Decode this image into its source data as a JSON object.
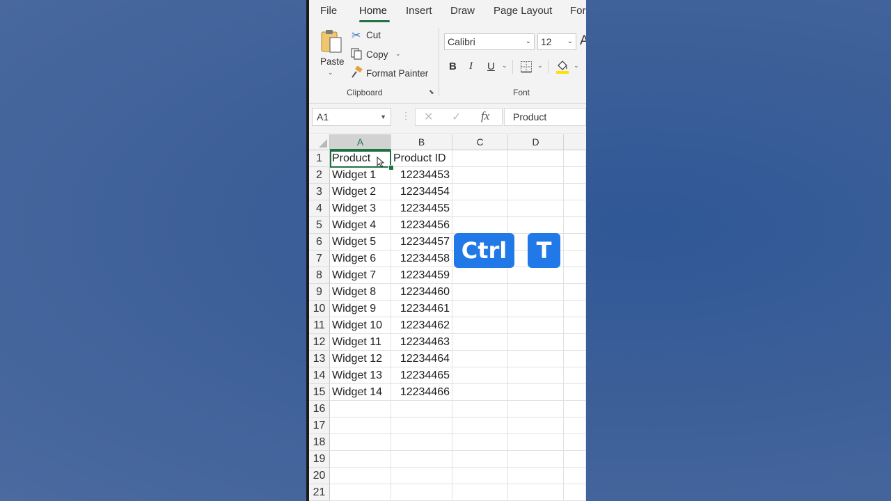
{
  "ribbon": {
    "tabs": [
      "File",
      "Home",
      "Insert",
      "Draw",
      "Page Layout",
      "For"
    ],
    "active_tab": "Home",
    "clipboard": {
      "paste_label": "Paste",
      "cut_label": "Cut",
      "copy_label": "Copy",
      "format_painter_label": "Format Painter",
      "group_label": "Clipboard"
    },
    "font": {
      "font_name": "Calibri",
      "font_size": "12",
      "bold": "B",
      "italic": "I",
      "underline": "U",
      "group_label": "Font"
    }
  },
  "formula_bar": {
    "name_box": "A1",
    "fx_label": "fx",
    "cancel_glyph": "✕",
    "enter_glyph": "✓",
    "content": "Product"
  },
  "sheet": {
    "columns": [
      "A",
      "B",
      "C",
      "D"
    ],
    "selected_column": "A",
    "row_numbers": [
      "1",
      "2",
      "3",
      "4",
      "5",
      "6",
      "7",
      "8",
      "9",
      "10",
      "11",
      "12",
      "13",
      "14",
      "15",
      "16",
      "17",
      "18",
      "19",
      "20",
      "21"
    ],
    "rows": [
      [
        "Product",
        "Product ID"
      ],
      [
        "Widget 1",
        "12234453"
      ],
      [
        "Widget 2",
        "12234454"
      ],
      [
        "Widget 3",
        "12234455"
      ],
      [
        "Widget 4",
        "12234456"
      ],
      [
        "Widget 5",
        "12234457"
      ],
      [
        "Widget 6",
        "12234458"
      ],
      [
        "Widget 7",
        "12234459"
      ],
      [
        "Widget 8",
        "12234460"
      ],
      [
        "Widget 9",
        "12234461"
      ],
      [
        "Widget 10",
        "12234462"
      ],
      [
        "Widget 11",
        "12234463"
      ],
      [
        "Widget 12",
        "12234464"
      ],
      [
        "Widget 13",
        "12234465"
      ],
      [
        "Widget 14",
        "12234466"
      ]
    ]
  },
  "shortcut": {
    "key1": "Ctrl",
    "key2": "T",
    "key_color": "#2079e7"
  },
  "colors": {
    "accent": "#1e7145",
    "background": "#3d5f98"
  },
  "icons": {
    "paste": "clipboard-paste-icon",
    "cut": "scissors-icon",
    "copy": "copy-icon",
    "format_painter": "paintbrush-icon",
    "borders": "borders-icon",
    "fill_color": "fill-bucket-icon"
  }
}
